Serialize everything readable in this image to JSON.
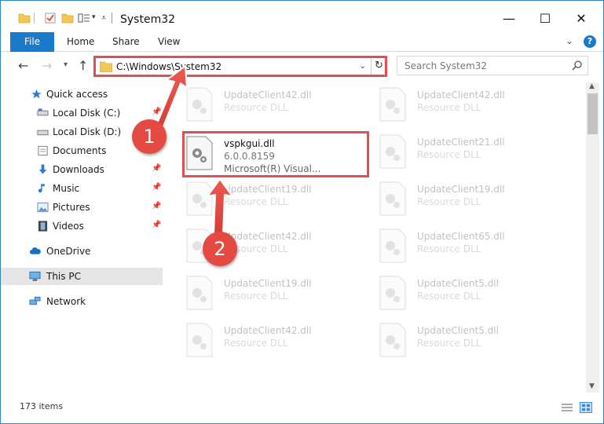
{
  "window": {
    "title": "System32",
    "buttons": {
      "minimize": "—",
      "maximize": "☐",
      "close": "✕"
    }
  },
  "ribbon": {
    "tabs": [
      "File",
      "Home",
      "Share",
      "View"
    ],
    "help": "?"
  },
  "nav": {
    "address": "C:\\Windows\\System32",
    "search_placeholder": "Search System32"
  },
  "sidebar": {
    "items": [
      {
        "label": "Quick access",
        "icon": "star-icon",
        "pinned": false
      },
      {
        "label": "Local Disk (C:)",
        "icon": "drive-icon",
        "pinned": true
      },
      {
        "label": "Local Disk (D:)",
        "icon": "drive-icon",
        "pinned": true
      },
      {
        "label": "Documents",
        "icon": "documents-icon",
        "pinned": true
      },
      {
        "label": "Downloads",
        "icon": "download-arrow-icon",
        "pinned": true
      },
      {
        "label": "Music",
        "icon": "music-note-icon",
        "pinned": true
      },
      {
        "label": "Pictures",
        "icon": "pictures-icon",
        "pinned": true
      },
      {
        "label": "Videos",
        "icon": "film-icon",
        "pinned": true
      },
      {
        "label": "OneDrive",
        "icon": "cloud-icon",
        "pinned": false
      },
      {
        "label": "This PC",
        "icon": "monitor-icon",
        "pinned": false
      },
      {
        "label": "Network",
        "icon": "network-icon",
        "pinned": false
      }
    ]
  },
  "files": {
    "highlighted": {
      "name": "vspkgui.dll",
      "version": "6.0.0.8159",
      "company": "Microsoft(R) Visual..."
    },
    "left_column": [
      {
        "name": "UpdateClient42.dll",
        "desc": "Resource DLL"
      },
      {
        "name": "UpdateClient19.dll",
        "desc": "Resource DLL"
      },
      {
        "name": "UpdateClient42.dll",
        "desc": "Resource DLL"
      },
      {
        "name": "UpdateClient19.dll",
        "desc": "Resource DLL"
      },
      {
        "name": "UpdateClient42.dll",
        "desc": "Resource DLL"
      }
    ],
    "right_column": [
      {
        "name": "UpdateClient42.dll",
        "desc": "Resource DLL"
      },
      {
        "name": "UpdateClient21.dll",
        "desc": "Resource DLL"
      },
      {
        "name": "UpdateClient19.dll",
        "desc": "Resource DLL"
      },
      {
        "name": "UpdateClient65.dll",
        "desc": "Resource DLL"
      },
      {
        "name": "UpdateClient5.dll",
        "desc": "Resource DLL"
      },
      {
        "name": "UpdateClient5.dll",
        "desc": "Resource DLL"
      }
    ]
  },
  "status": {
    "item_count": "173 items"
  },
  "annotations": {
    "step1": "1",
    "step2": "2"
  },
  "colors": {
    "accent": "#1979ca",
    "highlight": "#e15050",
    "badge": "#e44a42"
  }
}
